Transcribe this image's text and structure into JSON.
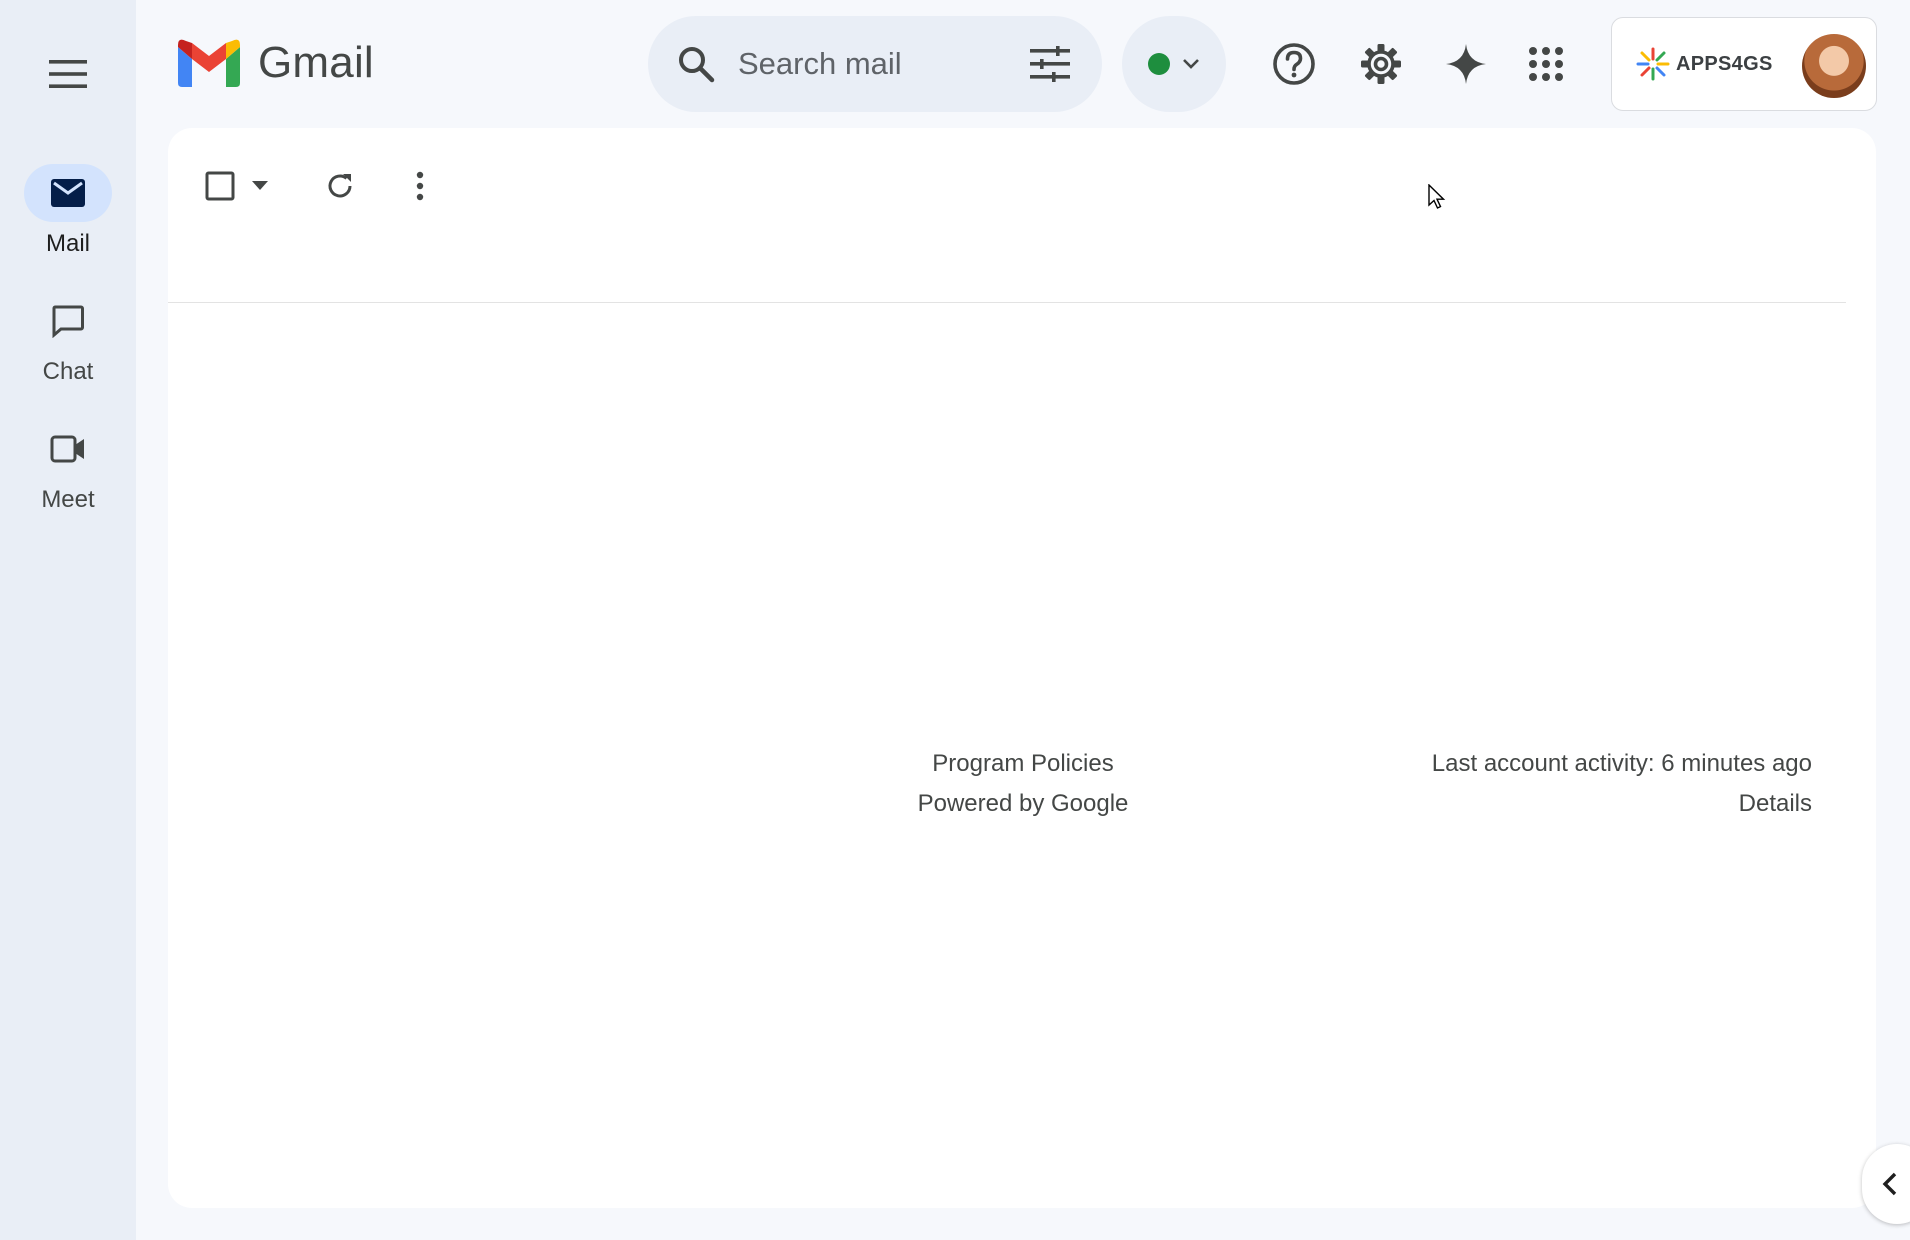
{
  "app": {
    "name": "Gmail"
  },
  "rail": {
    "items": [
      {
        "label": "Mail",
        "icon": "mail-icon",
        "active": true
      },
      {
        "label": "Chat",
        "icon": "chat-icon",
        "active": false
      },
      {
        "label": "Meet",
        "icon": "video-icon",
        "active": false
      }
    ]
  },
  "search": {
    "placeholder": "Search mail"
  },
  "status": {
    "color": "#1e8e3e"
  },
  "account": {
    "org_name": "APPS4GS"
  },
  "footer": {
    "program_policies": "Program Policies",
    "powered_by": "Powered by Google",
    "last_activity": "Last account activity: 6 minutes ago",
    "details": "Details"
  },
  "colors": {
    "rail_active": "#d3e3fd",
    "background": "#f6f8fc"
  }
}
